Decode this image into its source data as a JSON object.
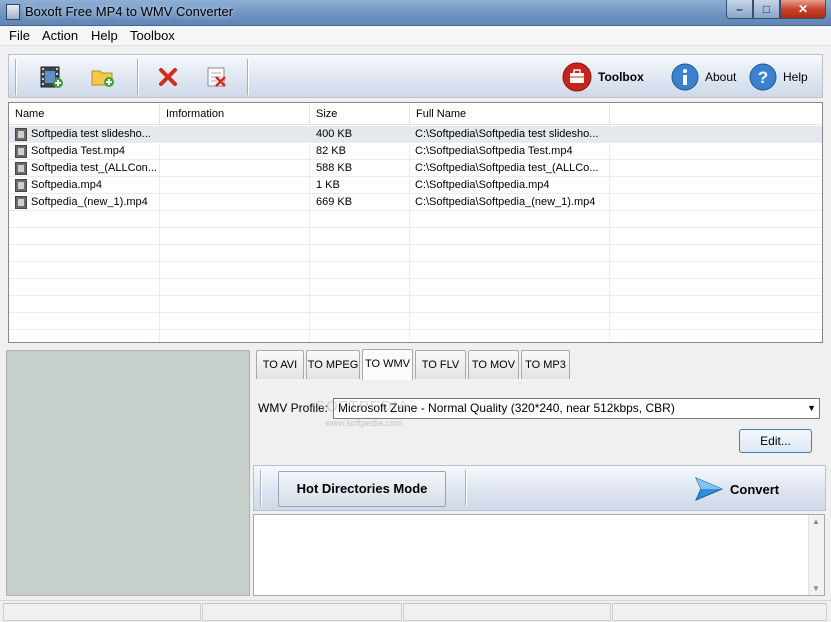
{
  "window": {
    "title": "Boxoft Free MP4 to WMV Converter",
    "minimize": "–",
    "maximize": "□",
    "close": "✕"
  },
  "menu": [
    "File",
    "Action",
    "Help",
    "Toolbox"
  ],
  "toolbar": {
    "buttons": [
      {
        "name": "add-file",
        "icon": "film-add-icon"
      },
      {
        "name": "add-folder",
        "icon": "folder-add-icon"
      },
      {
        "name": "remove",
        "icon": "red-x-icon"
      },
      {
        "name": "clear-list",
        "icon": "clear-list-icon"
      }
    ],
    "toolbox_label": "Toolbox",
    "about_label": "About",
    "help_label": "Help"
  },
  "file_list": {
    "columns": [
      "Name",
      "Imformation",
      "Size",
      "Full Name"
    ],
    "rows": [
      {
        "name": "Softpedia test slidesho...",
        "info": "",
        "size": "400 KB",
        "full": "C:\\Softpedia\\Softpedia test slidesho..."
      },
      {
        "name": "Softpedia Test.mp4",
        "info": "",
        "size": "82 KB",
        "full": "C:\\Softpedia\\Softpedia Test.mp4"
      },
      {
        "name": "Softpedia test_(ALLCon...",
        "info": "",
        "size": "588 KB",
        "full": "C:\\Softpedia\\Softpedia test_(ALLCo..."
      },
      {
        "name": "Softpedia.mp4",
        "info": "",
        "size": "1 KB",
        "full": "C:\\Softpedia\\Softpedia.mp4"
      },
      {
        "name": "Softpedia_(new_1).mp4",
        "info": "",
        "size": "669 KB",
        "full": "C:\\Softpedia\\Softpedia_(new_1).mp4"
      }
    ]
  },
  "format_tabs": [
    "TO AVI",
    "TO MPEG",
    "TO WMV",
    "TO FLV",
    "TO MOV",
    "TO MP3"
  ],
  "active_tab": "TO WMV",
  "profile": {
    "label": "WMV Profile:",
    "selected": "Microsoft Zune - Normal Quality (320*240, near 512kbps, CBR)",
    "edit_label": "Edit..."
  },
  "actions": {
    "hot_directories_label": "Hot Directories Mode",
    "convert_label": "Convert"
  },
  "watermark": {
    "text": "SOFTPEDIA",
    "url": "www.softpedia.com"
  },
  "colors": {
    "titlebar": "#6e93bf",
    "accent": "#3c7fb1",
    "close": "#c7432b"
  }
}
